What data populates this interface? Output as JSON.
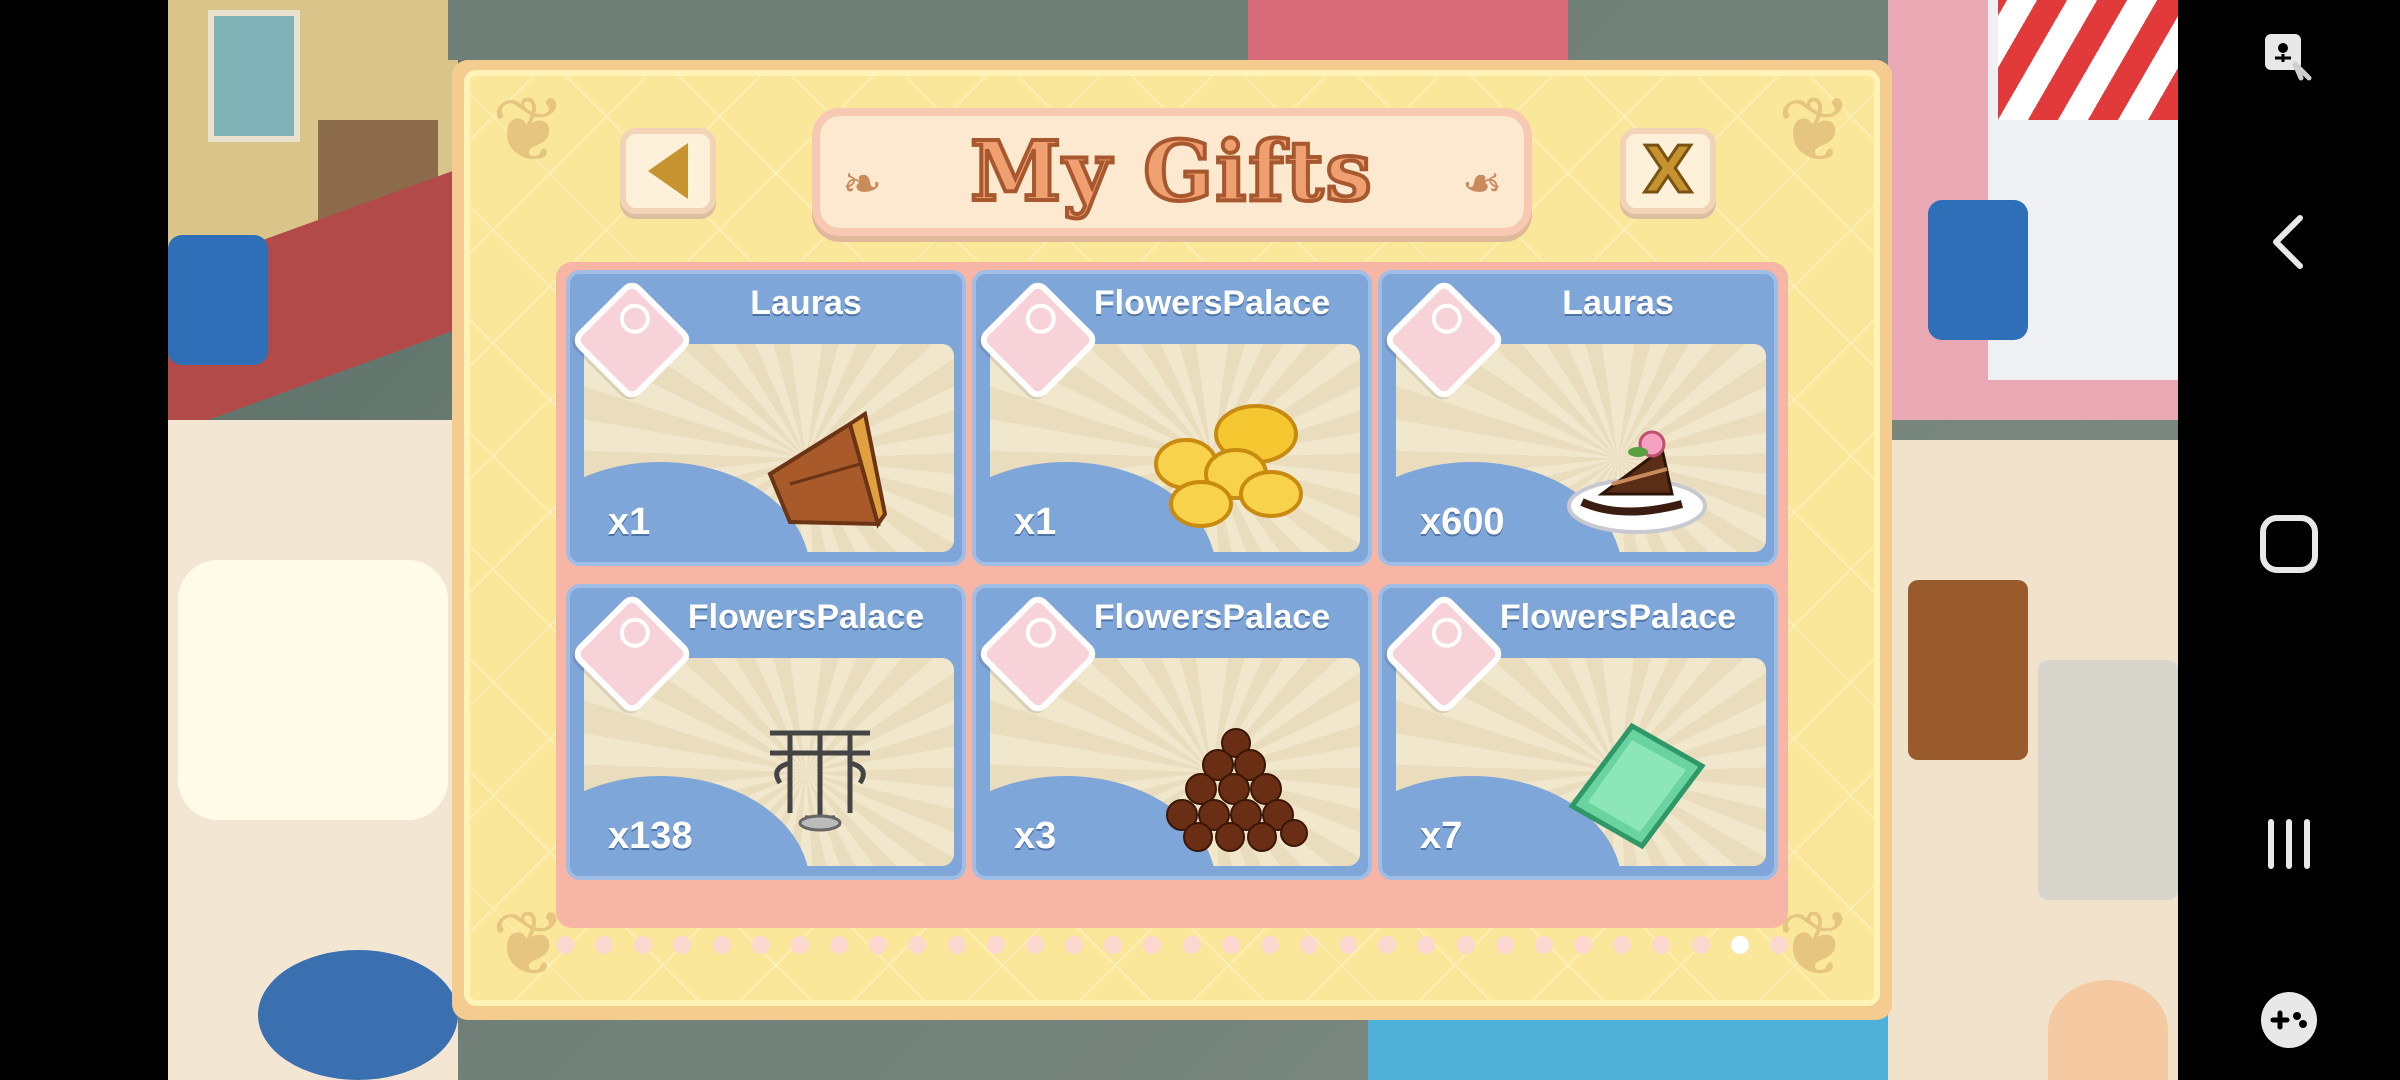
{
  "dialog": {
    "title": "My Gifts",
    "back_icon": "triangle-left-icon",
    "close_label": "X",
    "page_dots": {
      "count": 32,
      "active_index": 30
    }
  },
  "gifts": [
    {
      "sender": "Lauras",
      "quantity": "x1",
      "item_icon": "wooden-wedge-icon"
    },
    {
      "sender": "FlowersPalace",
      "quantity": "x1",
      "item_icon": "banana-slices-icon"
    },
    {
      "sender": "Lauras",
      "quantity": "x600",
      "item_icon": "cake-slice-icon"
    },
    {
      "sender": "FlowersPalace",
      "quantity": "x138",
      "item_icon": "iron-fence-piece-icon"
    },
    {
      "sender": "FlowersPalace",
      "quantity": "x3",
      "item_icon": "chocolate-balls-icon"
    },
    {
      "sender": "FlowersPalace",
      "quantity": "x7",
      "item_icon": "green-tile-icon"
    }
  ],
  "navbar": {
    "icons": [
      "accessibility-icon",
      "back-icon",
      "home-icon",
      "recents-icon",
      "game-launcher-icon"
    ]
  },
  "colors": {
    "dialog_bg": "#fbe79a",
    "card_blue": "#7fa6d8",
    "title_orange": "#f0a070",
    "frame_pink": "#f7b5a6"
  }
}
